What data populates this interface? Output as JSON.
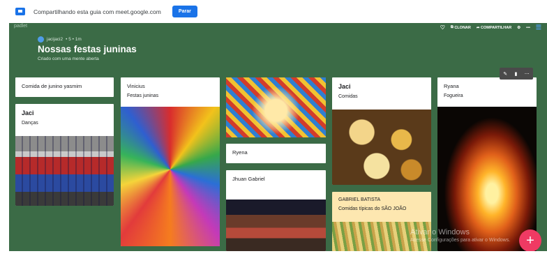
{
  "share_bar": {
    "message": "Compartilhando esta guia com meet.google.com",
    "stop_label": "Parar"
  },
  "board": {
    "brand": "padlet",
    "actions": {
      "clone_label": "CLONAR",
      "share_label": "COMPARTILHAR"
    },
    "author": "jacijaci2",
    "author_meta": "• 5 • 1m",
    "title": "Nossas festas juninas",
    "subtitle": "Criado com uma mente aberta"
  },
  "posts": {
    "c1": {
      "title": "Comida de junino yasmim"
    },
    "c2": {
      "title": "Jaci",
      "body": "Danças"
    },
    "c3": {
      "title": "Vinicius",
      "body": "Festas juninas"
    },
    "c4": {
      "title": "Ryena"
    },
    "c5": {
      "title": "Jhuan Gabriel"
    },
    "c6": {
      "title": "Jaci",
      "body": "Comidas"
    },
    "c7": {
      "title": "GABRIEL BATISTA",
      "body": "Comidas típicas do SÃO JOÃO"
    },
    "c8": {
      "title": "Ryana",
      "body": "Fogueira"
    }
  },
  "fab": {
    "label": "+"
  },
  "watermark": {
    "line1": "Ativar o Windows",
    "line2": "Acesse Configurações para ativar o Windows."
  },
  "colors": {
    "board_bg": "#3b6b46",
    "accent_blue": "#1a73e8",
    "fab_pink": "#ef3a63",
    "yellow_card": "#fde7b0"
  }
}
